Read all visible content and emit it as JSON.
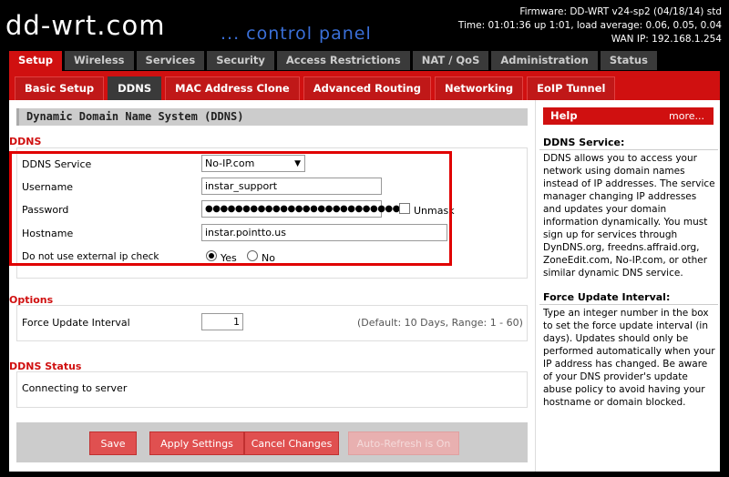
{
  "header": {
    "logo": "dd-wrt.com",
    "logo_sub": "... control panel",
    "firmware": "Firmware: DD-WRT v24-sp2 (04/18/14) std",
    "time": "Time: 01:01:36 up 1:01, load average: 0.06, 0.05, 0.04",
    "wan_ip": "WAN IP: 192.168.1.254"
  },
  "main_tabs": [
    "Setup",
    "Wireless",
    "Services",
    "Security",
    "Access Restrictions",
    "NAT / QoS",
    "Administration",
    "Status"
  ],
  "sub_tabs": [
    "Basic Setup",
    "DDNS",
    "MAC Address Clone",
    "Advanced Routing",
    "Networking",
    "EoIP Tunnel"
  ],
  "content_title": "Dynamic Domain Name System (DDNS)",
  "ddns": {
    "section": "DDNS",
    "service_label": "DDNS Service",
    "service_value": "No-IP.com",
    "username_label": "Username",
    "username_value": "instar_support",
    "password_label": "Password",
    "password_value": "●●●●●●●●●●●●●●●●●●●●●●●●●●",
    "unmask_label": "Unmask",
    "hostname_label": "Hostname",
    "hostname_value": "instar.pointto.us",
    "external_ip_label": "Do not use external ip check",
    "yes_label": "Yes",
    "no_label": "No"
  },
  "options": {
    "section": "Options",
    "force_label": "Force Update Interval",
    "force_value": "1",
    "force_hint": "(Default: 10 Days, Range: 1 - 60)"
  },
  "status": {
    "section": "DDNS Status",
    "text": "Connecting to server"
  },
  "buttons": {
    "save": "Save",
    "apply": "Apply Settings",
    "cancel": "Cancel Changes",
    "disabled": "Auto-Refresh is On"
  },
  "help": {
    "title": "Help",
    "more": "more...",
    "ddns_title": "DDNS Service:",
    "ddns_text": "DDNS allows you to access your network using domain names instead of IP addresses. The service manager changing IP addresses and updates your domain information dynamically. You must sign up for services through DynDNS.org, freedns.affraid.org, ZoneEdit.com, No-IP.com, or other similar dynamic DNS service.",
    "force_title": "Force Update Interval:",
    "force_text": "Type an integer number in the box to set the force update interval (in days). Updates should only be performed automatically when your IP address has changed. Be aware of your DNS provider's update abuse policy to avoid having your hostname or domain blocked."
  }
}
